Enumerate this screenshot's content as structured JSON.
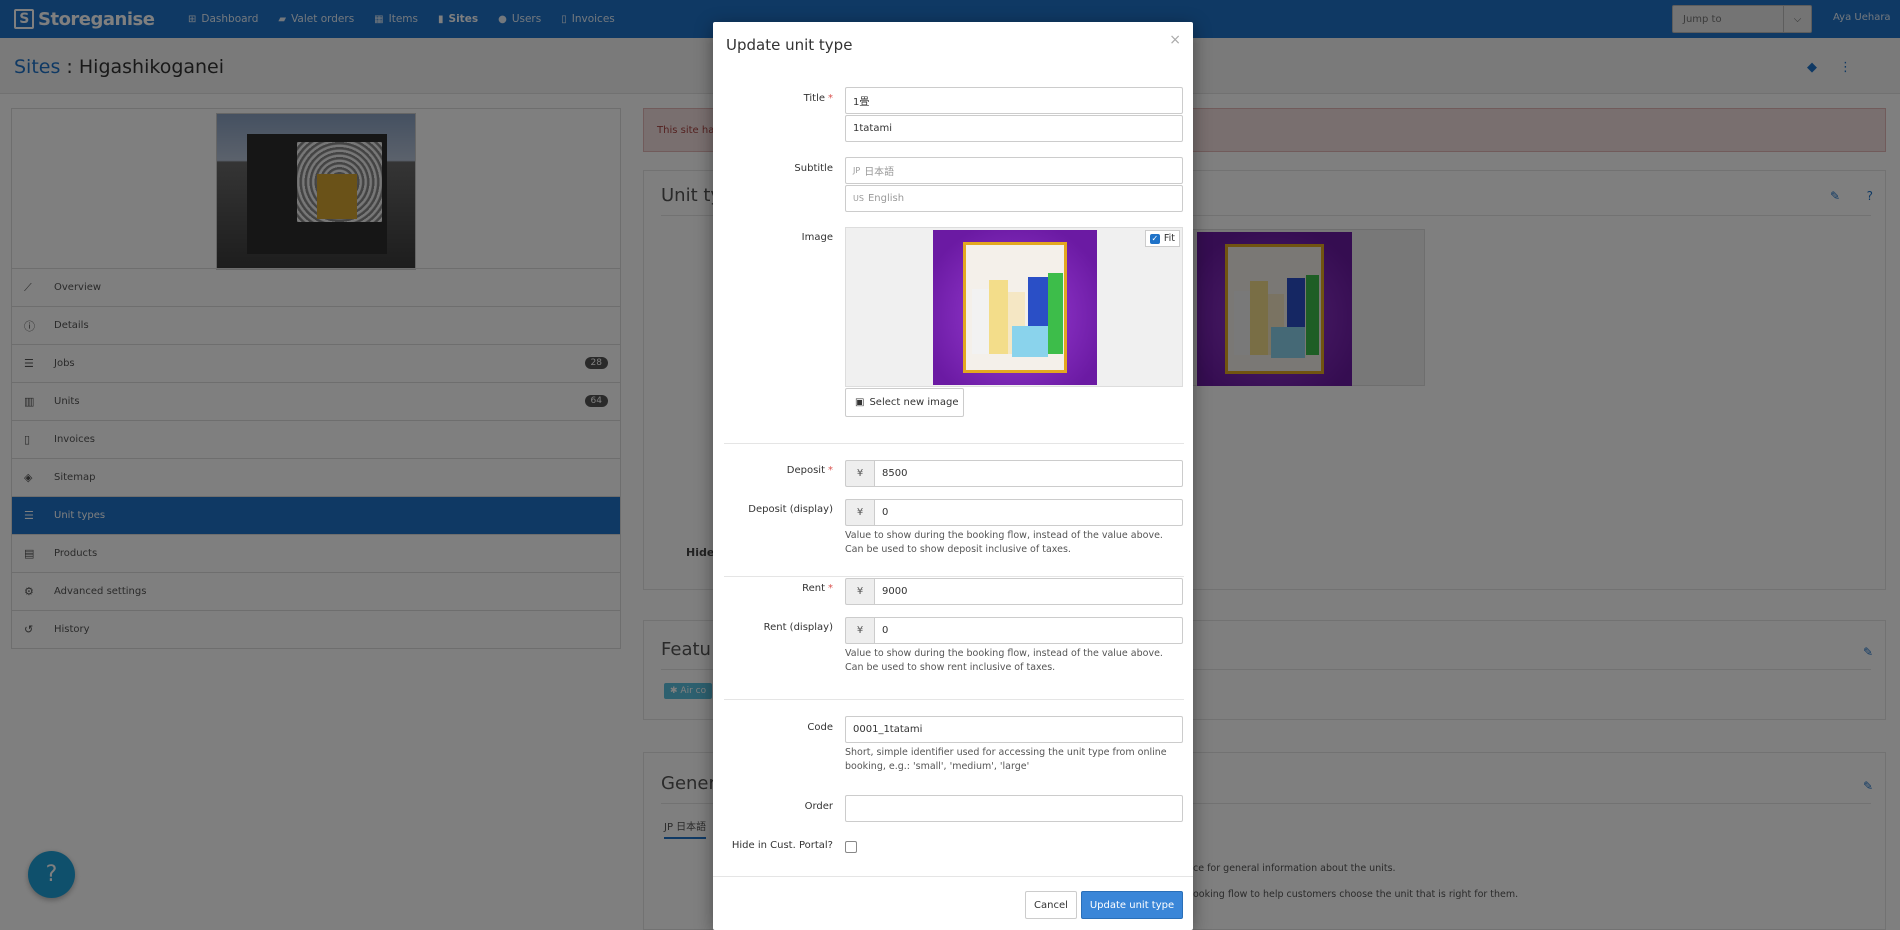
{
  "navbar": {
    "brand": "Storeganise",
    "items": [
      {
        "icon": "sitemap-icon",
        "label": "Dashboard"
      },
      {
        "icon": "truck-icon",
        "label": "Valet orders"
      },
      {
        "icon": "box-icon",
        "label": "Items"
      },
      {
        "icon": "building-icon",
        "label": "Sites"
      },
      {
        "icon": "user-icon",
        "label": "Users"
      },
      {
        "icon": "file-icon",
        "label": "Invoices"
      }
    ],
    "jump_placeholder": "Jump to",
    "user_name": "Aya Uehara"
  },
  "page": {
    "breadcrumb": "Sites",
    "separator": " : ",
    "title": "Higashikoganei"
  },
  "sidebar": {
    "items": [
      {
        "icon": "chart-icon",
        "label": "Overview"
      },
      {
        "icon": "info-icon",
        "label": "Details"
      },
      {
        "icon": "list-icon",
        "label": "Jobs",
        "badge": "28"
      },
      {
        "icon": "building-icon",
        "label": "Units",
        "badge": "64"
      },
      {
        "icon": "invoice-icon",
        "label": "Invoices"
      },
      {
        "icon": "layers-icon",
        "label": "Sitemap"
      },
      {
        "icon": "list-icon",
        "label": "Unit types",
        "active": true
      },
      {
        "icon": "boxes-icon",
        "label": "Products"
      },
      {
        "icon": "gear-icon",
        "label": "Advanced settings"
      },
      {
        "icon": "history-icon",
        "label": "History"
      }
    ]
  },
  "background": {
    "alert_text": "This site has",
    "unit_types_heading": "Unit ty",
    "hide_label": "Hide",
    "features_heading": "Featu",
    "feature_tag": "Air co",
    "general_heading": "Gener",
    "general_tab": "JP 日本語",
    "general_text_1": "ce for general information about the units.",
    "general_text_2": "ooking flow to help customers choose the unit that is right for them."
  },
  "modal": {
    "title": "Update unit type",
    "close": "×",
    "title_label": "Title",
    "title_jp_value": "1畳",
    "title_en_value": "1tatami",
    "subtitle_label": "Subtitle",
    "subtitle_jp_prefix": "JP",
    "subtitle_jp_placeholder": "日本語",
    "subtitle_en_prefix": "US",
    "subtitle_en_placeholder": "English",
    "image_label": "Image",
    "fit_label": "Fit",
    "select_image_label": "Select new image",
    "deposit_label": "Deposit",
    "deposit_value": "8500",
    "deposit_display_label": "Deposit (display)",
    "deposit_display_value": "0",
    "deposit_help": "Value to show during the booking flow, instead of the value above. Can be used to show deposit inclusive of taxes.",
    "rent_label": "Rent",
    "rent_value": "9000",
    "rent_display_label": "Rent (display)",
    "rent_display_value": "0",
    "rent_help": "Value to show during the booking flow, instead of the value above. Can be used to show rent inclusive of taxes.",
    "code_label": "Code",
    "code_value": "0001_1tatami",
    "code_help": "Short, simple identifier used for accessing the unit type from online booking, e.g.: 'small', 'medium', 'large'",
    "order_label": "Order",
    "order_value": "",
    "hide_label": "Hide in Cust. Portal?",
    "currency": "¥",
    "required_mark": "*",
    "cancel_label": "Cancel",
    "update_label": "Update unit type"
  },
  "help_button": "?",
  "colors": {
    "primary": "#1e72c8",
    "alert_bg": "#f2dede",
    "update_button": "#3a86d8"
  }
}
